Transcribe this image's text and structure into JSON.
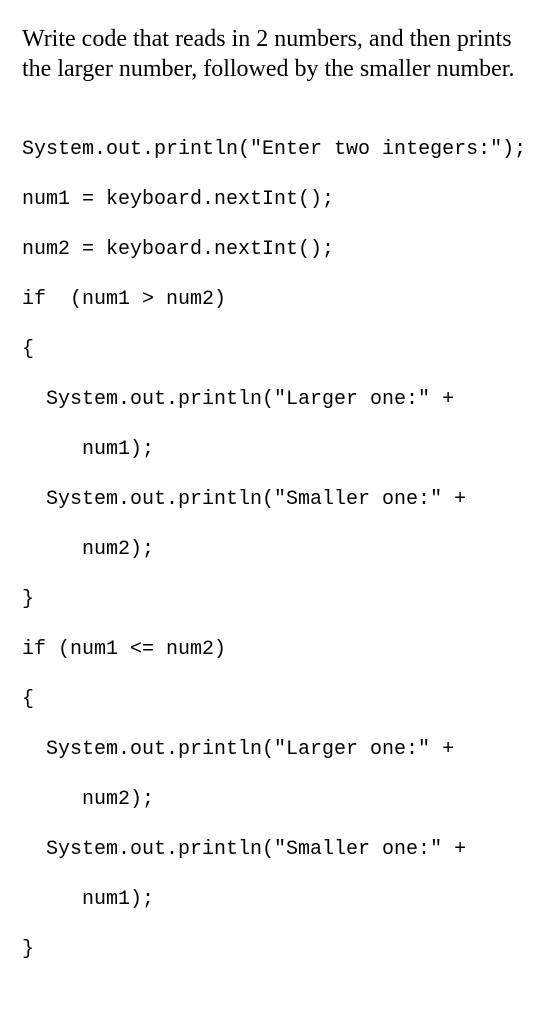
{
  "prompt": "Write code that reads in 2 numbers, and then prints the larger number, followed by the smaller number.",
  "code": {
    "l01": "System.out.println(\"Enter two integers:\");",
    "l02": "num1 = keyboard.nextInt();",
    "l03": "num2 = keyboard.nextInt();",
    "l04": "if  (num1 > num2)",
    "l05": "{",
    "l06": "System.out.println(\"Larger one:\" +",
    "l07": "num1);",
    "l08": "System.out.println(\"Smaller one:\" +",
    "l09": "num2);",
    "l10": "}",
    "l11": "if (num1 <= num2)",
    "l12": "{",
    "l13": "System.out.println(\"Larger one:\" +",
    "l14": "num2);",
    "l15": "System.out.println(\"Smaller one:\" +",
    "l16": "num1);",
    "l17": "}"
  }
}
